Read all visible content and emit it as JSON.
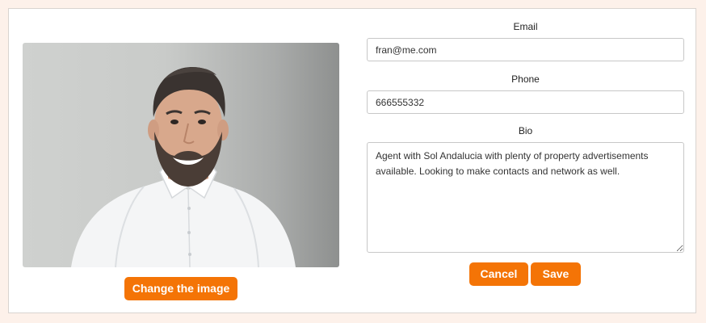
{
  "profile": {
    "photo_alt": "",
    "change_image_label": "Change the image"
  },
  "form": {
    "email": {
      "label": "Email",
      "value": "fran@me.com"
    },
    "phone": {
      "label": "Phone",
      "value": "666555332"
    },
    "bio": {
      "label": "Bio",
      "value": "Agent with Sol Andalucia with plenty of property advertisements available. Looking to make contacts and network as well."
    },
    "cancel_label": "Cancel",
    "save_label": "Save"
  },
  "colors": {
    "accent": "#f47406",
    "page_background": "#fdf1ea",
    "card_background": "#ffffff"
  }
}
